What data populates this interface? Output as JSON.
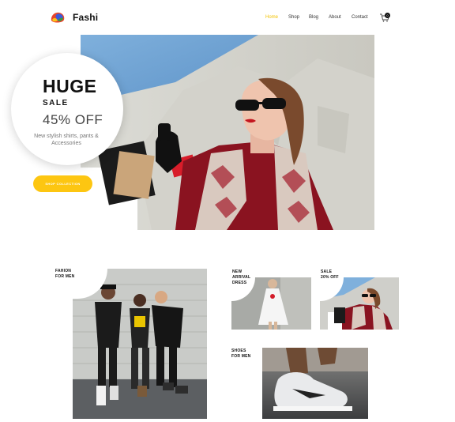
{
  "header": {
    "brand": "Fashi",
    "nav": [
      {
        "label": "Home",
        "active": true
      },
      {
        "label": "Shop"
      },
      {
        "label": "Blog"
      },
      {
        "label": "About"
      },
      {
        "label": "Contact"
      }
    ],
    "cart_count": "0"
  },
  "hero": {
    "title": "HUGE",
    "subtitle": "SALE",
    "discount": "45% OFF",
    "description": "New stylish shirts, pants & Accessories",
    "button_label": "SHOP COLLECTION"
  },
  "categories": [
    {
      "label": "FAHION FOR MEN"
    },
    {
      "label": "NEW ARRIVAL DRESS"
    },
    {
      "label": "SALE 20% OFF"
    },
    {
      "label": "SHOES FOR MEN"
    }
  ],
  "colors": {
    "accent": "#fdc611",
    "active_nav": "#f2c200",
    "text": "#111111"
  }
}
